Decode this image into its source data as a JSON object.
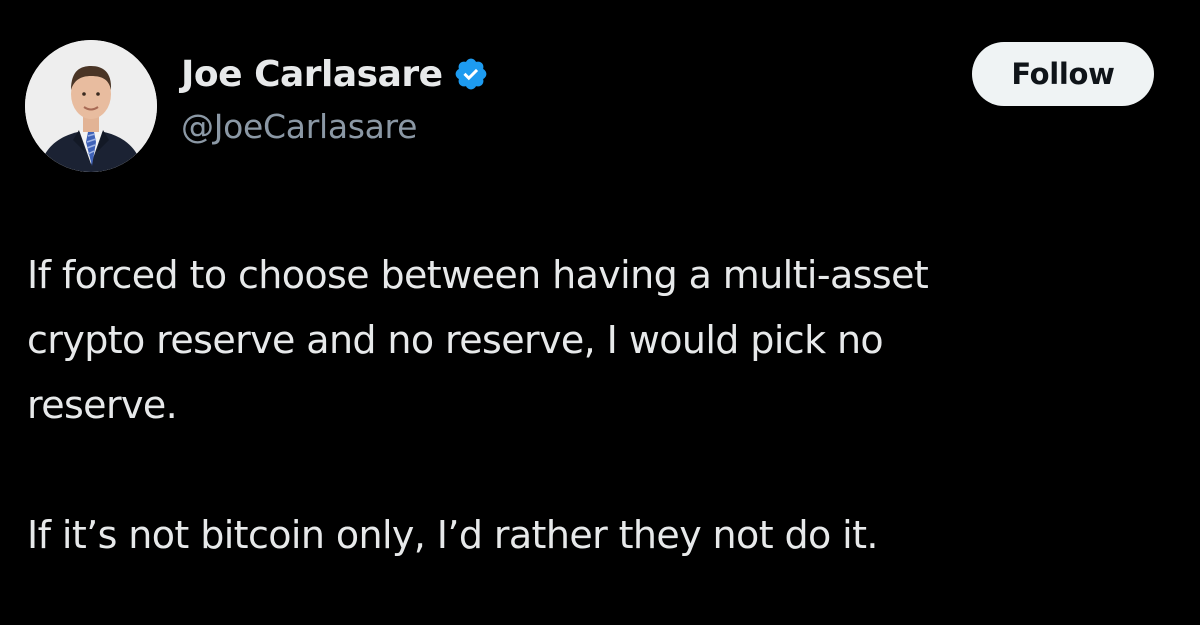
{
  "author": {
    "display_name": "Joe Carlasare",
    "handle": "@JoeCarlasare",
    "verified": true,
    "verified_badge_color": "#1d9bf0"
  },
  "actions": {
    "follow_label": "Follow"
  },
  "tweet": {
    "paragraph_1": "If forced to choose between having a multi-asset\ncrypto reserve and no reserve, I would pick no\nreserve.",
    "paragraph_2": "If it’s not bitcoin only, I’d rather they not do it."
  },
  "theme": {
    "background": "#000000",
    "text": "#e7e9ea",
    "secondary_text": "#8b98a5",
    "button_bg": "#eff3f4"
  }
}
